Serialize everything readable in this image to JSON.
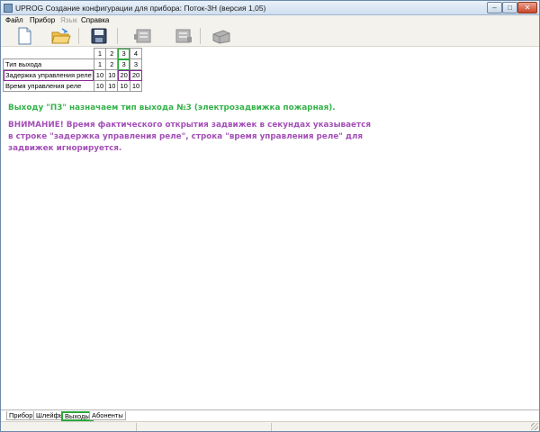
{
  "window": {
    "title": "UPROG  Создание конфигурации для прибора: Поток-3Н (версия  1,05)",
    "minimize_glyph": "–",
    "maximize_glyph": "□",
    "close_glyph": "✕"
  },
  "menu": {
    "items": [
      {
        "label": "Файл",
        "enabled": true
      },
      {
        "label": "Прибор",
        "enabled": true
      },
      {
        "label": "Язык",
        "enabled": false
      },
      {
        "label": "Справка",
        "enabled": true
      }
    ]
  },
  "toolbar": {
    "buttons": [
      {
        "name": "new-file-icon",
        "enabled": true
      },
      {
        "name": "open-folder-icon",
        "enabled": true
      },
      {
        "name": "save-disk-icon",
        "enabled": true
      },
      {
        "name": "read-device-icon",
        "enabled": false
      },
      {
        "name": "write-device-icon",
        "enabled": false
      },
      {
        "name": "connect-device-icon",
        "enabled": false
      }
    ]
  },
  "table": {
    "columns": [
      "1",
      "2",
      "3",
      "4"
    ],
    "rows": [
      {
        "label": "Тип выхода",
        "values": [
          "1",
          "2",
          "3",
          "3"
        ]
      },
      {
        "label": "Задержка управления реле",
        "values": [
          "10",
          "10",
          "20",
          "20"
        ]
      },
      {
        "label": "Время управления реле",
        "values": [
          "10",
          "10",
          "10",
          "10"
        ]
      }
    ]
  },
  "notes": {
    "green": "Выходу \"П3\" назначаем тип выхода №3 (электрозадвижка пожарная).",
    "purple": "ВНИМАНИЕ! Время фактического открытия задвижек в секундах указывается в строке \"задержка управления реле\", строка \"время управления реле\" для задвижек игнорируется."
  },
  "tabs": [
    {
      "label": "Прибор",
      "active": false
    },
    {
      "label": "Шлейфы",
      "active": false
    },
    {
      "label": "Выходы",
      "active": true
    },
    {
      "label": "Абоненты",
      "active": false
    }
  ],
  "colors": {
    "green_note": "#34b24a",
    "purple_note": "#a34fb6",
    "highlight_green": "#2ca73a",
    "highlight_purple": "#8a2c96"
  }
}
